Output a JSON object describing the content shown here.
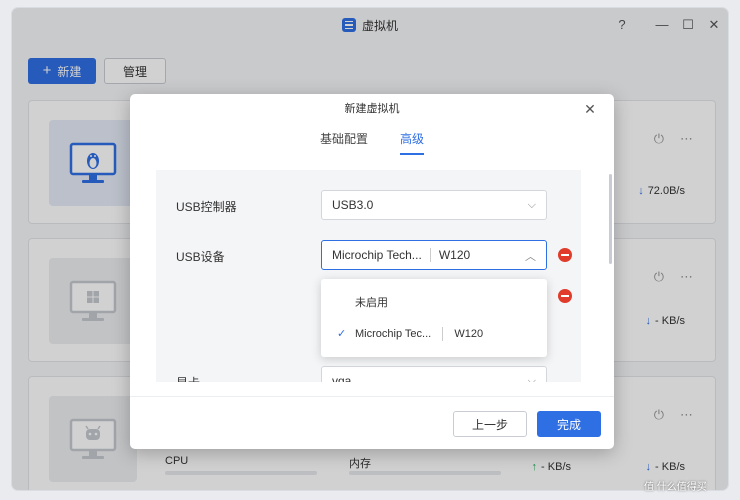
{
  "window": {
    "title": "虚拟机"
  },
  "toolbar": {
    "new_label": "新建",
    "manage_label": "管理"
  },
  "cards": [
    {
      "net_down": "72.0B/s"
    },
    {
      "net_down": "- KB/s"
    },
    {
      "cpu_label": "CPU",
      "memory_label": "内存",
      "net_up": "- KB/s",
      "net_down": "- KB/s"
    }
  ],
  "modal": {
    "title": "新建虚拟机",
    "tabs": [
      {
        "label": "基础配置"
      },
      {
        "label": "高级"
      }
    ],
    "usb_controller": {
      "label": "USB控制器",
      "value": "USB3.0"
    },
    "usb_device": {
      "label": "USB设备",
      "device": "Microchip Tech...",
      "model": "W120"
    },
    "dropdown": {
      "options": [
        {
          "label": "未启用"
        },
        {
          "label": "Microchip Tec...",
          "model": "W120",
          "selected": true
        }
      ]
    },
    "gpu": {
      "label": "显卡",
      "value": "vga"
    },
    "footer": {
      "prev_label": "上一步",
      "done_label": "完成"
    }
  },
  "watermark": "值 什么值得买",
  "colors": {
    "accent": "#2f6fe4",
    "danger": "#e03b2b",
    "upload": "#1eae5e"
  }
}
